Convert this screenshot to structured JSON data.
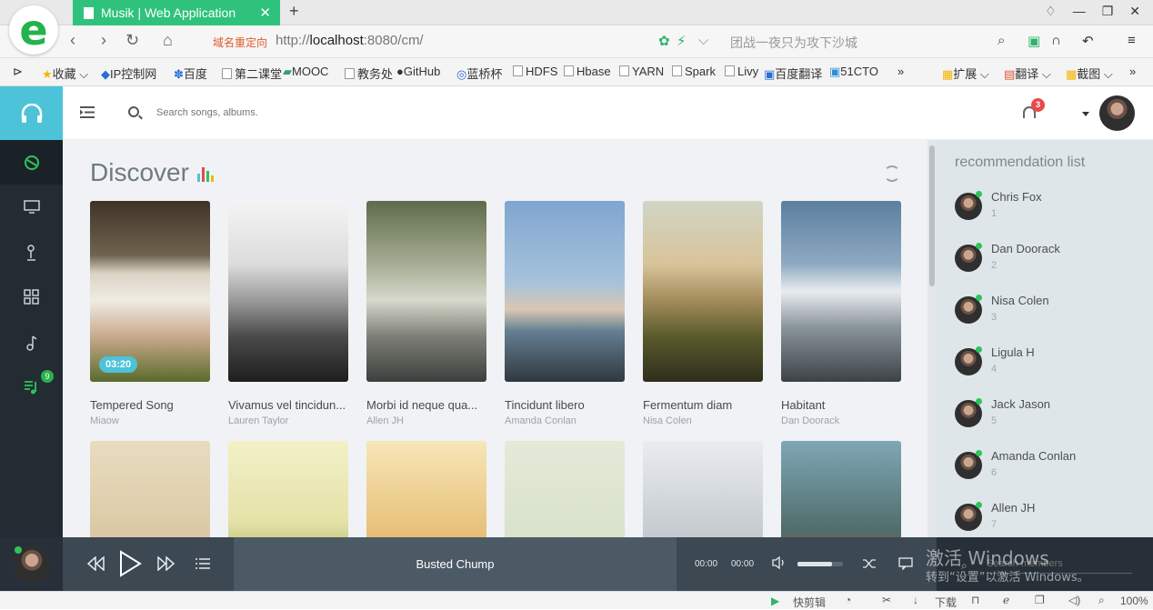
{
  "browser": {
    "tab_title": "Musik | Web Application",
    "redirect_label": "域名重定向",
    "url_prefix": "http://",
    "url_host": "localhost",
    "url_rest": ":8080/cm/",
    "hint_text": "团战一夜只为攻下沙城",
    "bookmarks": [
      "收藏",
      "IP控制网",
      "百度",
      "第二课堂",
      "MOOC",
      "教务处",
      "GitHub",
      "蓝桥杯",
      "HDFS",
      "Hbase",
      "YARN",
      "Spark",
      "Livy",
      "百度翻译",
      "51CTO",
      "»",
      "扩展",
      "翻译",
      "截图",
      "»"
    ]
  },
  "header": {
    "search_placeholder": "Search songs, albums.",
    "notification_count": "3"
  },
  "sidebar": {
    "playlist_badge": "9"
  },
  "discover": {
    "title": "Discover",
    "cards": [
      {
        "title": "Tempered Song",
        "artist": "Miaow",
        "duration": "03:20"
      },
      {
        "title": "Vivamus vel tincidun...",
        "artist": "Lauren Taylor"
      },
      {
        "title": "Morbi id neque qua...",
        "artist": "Allen JH"
      },
      {
        "title": "Tincidunt libero",
        "artist": "Amanda Conlan"
      },
      {
        "title": "Fermentum diam",
        "artist": "Nisa Colen"
      },
      {
        "title": "Habitant",
        "artist": "Dan Doorack"
      }
    ]
  },
  "recommendation": {
    "title": "recommendation list",
    "members": [
      {
        "name": "Chris Fox",
        "num": "1"
      },
      {
        "name": "Dan Doorack",
        "num": "2"
      },
      {
        "name": "Nisa Colen",
        "num": "3"
      },
      {
        "name": "Ligula H",
        "num": "4"
      },
      {
        "name": "Jack Jason",
        "num": "5"
      },
      {
        "name": "Amanda Conlan",
        "num": "6"
      },
      {
        "name": "Allen JH",
        "num": "7"
      }
    ]
  },
  "player": {
    "track": "Busted Chump",
    "time_current": "00:00",
    "time_total": "00:00",
    "volume": 0.75,
    "search_members_placeholder": "Search members"
  },
  "watermark": {
    "line1": "激活 Windows",
    "line2": "转到“设置”以激活 Windows。"
  },
  "statusbar": {
    "quick_cut": "快剪辑",
    "download": "下载",
    "zoom": "100%"
  },
  "colors": {
    "accent": "#4cc3d9",
    "tab_green": "#2fc27c",
    "sidebar_dark": "#232c33",
    "online": "#2ec45c"
  }
}
